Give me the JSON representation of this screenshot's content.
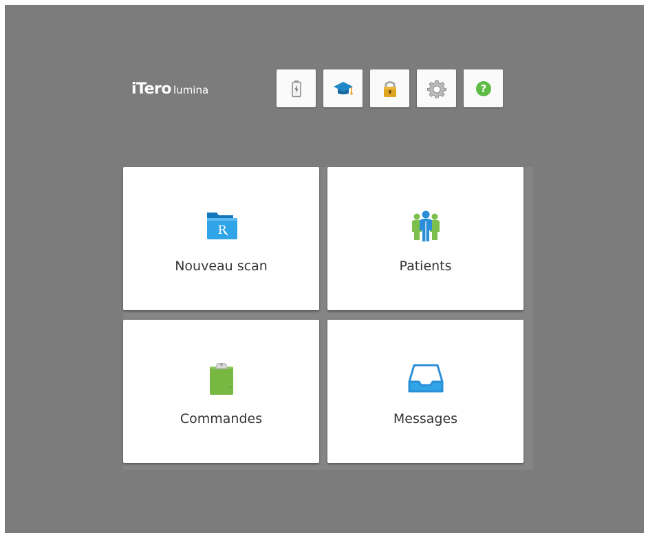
{
  "logo": {
    "brand": "iTero",
    "sub": "lumina"
  },
  "toolbar": {
    "items": [
      {
        "icon": "battery-icon",
        "color": "#6a6a6a"
      },
      {
        "icon": "graduation-cap-icon",
        "color": "#1e88c9"
      },
      {
        "icon": "lock-icon",
        "color": "#e0a521"
      },
      {
        "icon": "gear-icon",
        "color": "#8e8e8e"
      },
      {
        "icon": "help-icon",
        "color": "#5dbb46"
      }
    ]
  },
  "tiles": [
    {
      "label": "Nouveau scan",
      "icon": "rx-folder-icon",
      "color": "#1e90d6"
    },
    {
      "label": "Patients",
      "icon": "patients-group-icon",
      "color": "#2a8fd8"
    },
    {
      "label": "Commandes",
      "icon": "clipboard-icon",
      "color": "#77b843"
    },
    {
      "label": "Messages",
      "icon": "inbox-tray-icon",
      "color": "#2a8fd8"
    }
  ],
  "colors": {
    "background": "#7c7c7c",
    "tile_background": "#ffffff",
    "text": "#333333"
  }
}
